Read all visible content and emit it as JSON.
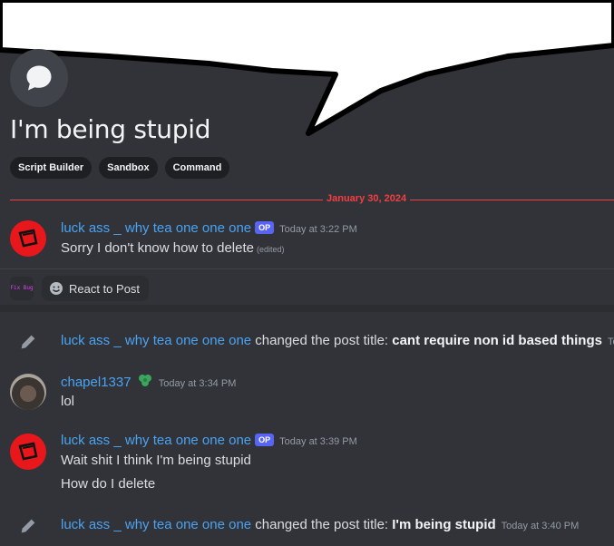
{
  "thread": {
    "title": "I'm being stupid",
    "tags": [
      "Script Builder",
      "Sandbox",
      "Command"
    ],
    "date_divider": "January 30, 2024"
  },
  "first_post": {
    "author": "luck ass _ why tea one one one",
    "badge": "OP",
    "time": "Today at 3:22 PM",
    "text": "Sorry I don't know how to delete",
    "edited": "(edited)"
  },
  "reactions": {
    "fixbug_label": "Fix Bug",
    "react_label": "React to Post"
  },
  "messages": [
    {
      "type": "system",
      "author": "luck ass _ why tea one one one",
      "action": " changed the post title: ",
      "new_title": "cant require non id based things",
      "time": "To"
    },
    {
      "type": "message",
      "author": "chapel1337",
      "time": "Today at 3:34 PM",
      "lines": [
        "lol"
      ]
    },
    {
      "type": "message",
      "author": "luck ass _ why tea one one one",
      "badge": "OP",
      "time": "Today at 3:39 PM",
      "lines": [
        "Wait shit I think I'm being stupid",
        "How do I delete"
      ]
    },
    {
      "type": "system",
      "author": "luck ass _ why tea one one one",
      "action": " changed the post title: ",
      "new_title": "I'm being stupid",
      "time": "Today at 3:40 PM"
    }
  ],
  "colors": {
    "background": "#313338",
    "link": "#4aa3f2",
    "divider": "#f23f43",
    "op_badge": "#5865f2",
    "avatar_red": "#e8171c"
  },
  "icons": [
    "chat-bubble-icon",
    "pencil-icon",
    "emoji-icon",
    "leaf-icon"
  ]
}
